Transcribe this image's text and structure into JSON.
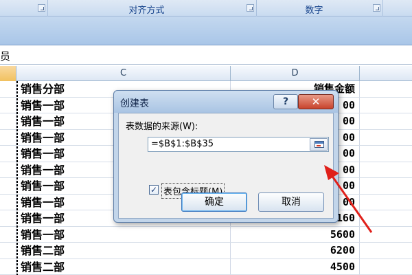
{
  "ribbon": {
    "groups": [
      "对齐方式",
      "数字"
    ]
  },
  "formula_bar": {
    "text": "员"
  },
  "columns": [
    "C",
    "D"
  ],
  "rows": [
    {
      "c": "销售分部",
      "d": "销售金额"
    },
    {
      "c": "销售一部",
      "d": "00"
    },
    {
      "c": "销售一部",
      "d": "00"
    },
    {
      "c": "销售一部",
      "d": "00"
    },
    {
      "c": "销售一部",
      "d": "00"
    },
    {
      "c": "销售一部",
      "d": "00"
    },
    {
      "c": "销售一部",
      "d": "00"
    },
    {
      "c": "销售一部",
      "d": "00"
    },
    {
      "c": "销售一部",
      "d": "3160"
    },
    {
      "c": "销售一部",
      "d": "5600"
    },
    {
      "c": "销售二部",
      "d": "6200"
    },
    {
      "c": "销售二部",
      "d": "4500"
    }
  ],
  "dialog": {
    "title": "创建表",
    "help_label": "?",
    "close_label": "✕",
    "source_label": "表数据的来源(W):",
    "range_value": "=$B$1:$B$35",
    "headers_checkbox_label": "表包含标题(M)",
    "headers_checked": true,
    "ok_label": "确定",
    "cancel_label": "取消"
  },
  "colors": {
    "annotation_arrow": "#e0201a",
    "ribbon_text": "#15428b"
  }
}
